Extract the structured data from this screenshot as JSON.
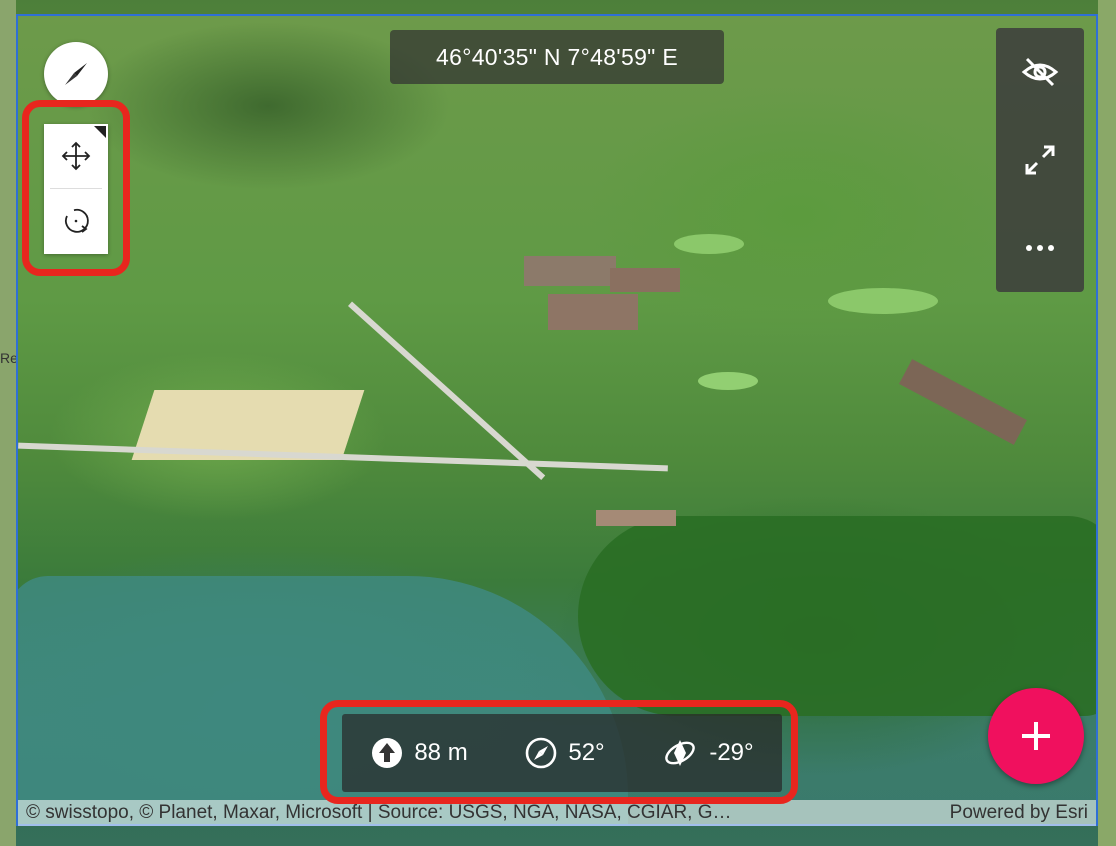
{
  "map": {
    "coordinates": "46°40'35\" N 7°48'59\" E",
    "edge_label": "Re"
  },
  "stats": {
    "elevation": "88 m",
    "heading": "52°",
    "tilt": "-29°"
  },
  "attribution": {
    "sources": "© swisstopo, © Planet, Maxar, Microsoft | Source: USGS, NGA, NASA, CGIAR, G…",
    "powered_by": "Powered by Esri"
  },
  "tools": {
    "icons": [
      "hide-icon",
      "expand-icon",
      "more-icon"
    ]
  },
  "navigation": {
    "icons": [
      "compass-icon",
      "pan-icon",
      "rotate-icon"
    ],
    "active_mode": "pan"
  },
  "colors": {
    "highlight": "#e8261e",
    "fab": "#f0105e",
    "map_border": "#2f6fd6"
  }
}
